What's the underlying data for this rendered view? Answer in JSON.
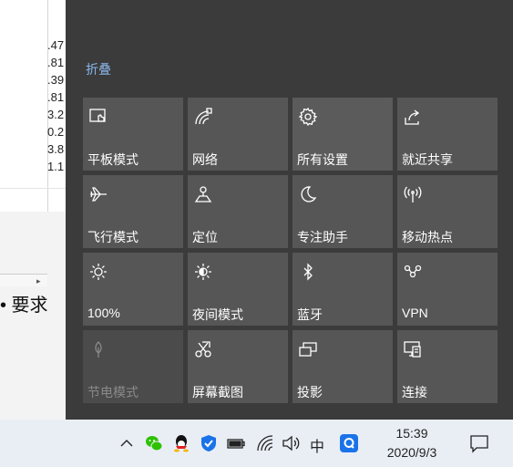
{
  "background": {
    "numbers": [
      ".47",
      ".81",
      ".39",
      ".81",
      "3.2",
      "0.2",
      "3.8",
      "1.1"
    ],
    "partial_text": "• 要求"
  },
  "action_center": {
    "collapse_label": "折叠",
    "tiles": [
      {
        "label": "平板模式",
        "icon": "tablet-mode-icon"
      },
      {
        "label": "网络",
        "icon": "network-icon"
      },
      {
        "label": "所有设置",
        "icon": "settings-gear-icon"
      },
      {
        "label": "就近共享",
        "icon": "nearby-share-icon"
      },
      {
        "label": "飞行模式",
        "icon": "airplane-icon"
      },
      {
        "label": "定位",
        "icon": "location-icon"
      },
      {
        "label": "专注助手",
        "icon": "moon-icon"
      },
      {
        "label": "移动热点",
        "icon": "hotspot-icon"
      },
      {
        "label": "100%",
        "icon": "brightness-icon"
      },
      {
        "label": "夜间模式",
        "icon": "night-light-icon"
      },
      {
        "label": "蓝牙",
        "icon": "bluetooth-icon"
      },
      {
        "label": "VPN",
        "icon": "vpn-icon"
      },
      {
        "label": "节电模式",
        "icon": "battery-saver-icon",
        "disabled": true
      },
      {
        "label": "屏幕截图",
        "icon": "screen-snip-icon"
      },
      {
        "label": "投影",
        "icon": "project-icon"
      },
      {
        "label": "连接",
        "icon": "connect-icon"
      }
    ]
  },
  "taskbar": {
    "ime_label": "中",
    "time": "15:39",
    "date": "2020/9/3",
    "tray_icons": [
      "chevron-up-icon",
      "wechat-icon",
      "qq-icon",
      "security-shield-icon",
      "battery-icon",
      "wifi-icon",
      "volume-icon",
      "ime-indicator",
      "app-q-icon"
    ],
    "accent_color": "#1a73e8"
  }
}
